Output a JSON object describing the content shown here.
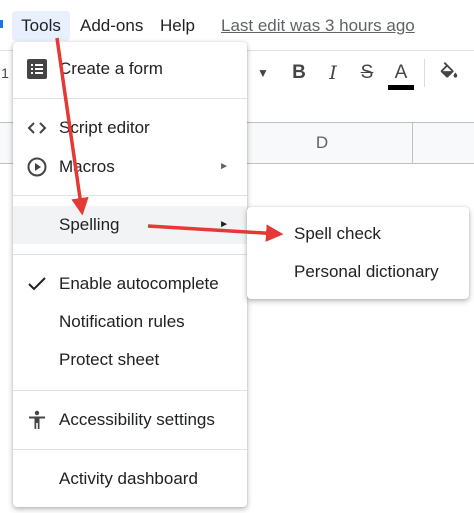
{
  "menubar": {
    "tools": "Tools",
    "addons": "Add-ons",
    "help": "Help",
    "last_edit": "Last edit was 3 hours ago"
  },
  "toolbar": {
    "font_size_fragment": "1",
    "bold": "B",
    "italic": "I",
    "strike": "S",
    "text_color": "A",
    "text_color_hex": "#000000"
  },
  "grid": {
    "column_d": "D"
  },
  "tools_menu": {
    "items": [
      {
        "label": "Create a form",
        "icon": "form-icon"
      },
      {
        "label": "Script editor",
        "icon": "code-icon"
      },
      {
        "label": "Macros",
        "icon": "play-circle-icon",
        "submenu": true
      },
      {
        "label": "Spelling",
        "icon": "",
        "submenu": true,
        "highlighted": true
      },
      {
        "label": "Enable autocomplete",
        "icon": "check-icon",
        "checked": true
      },
      {
        "label": "Notification rules",
        "icon": ""
      },
      {
        "label": "Protect sheet",
        "icon": ""
      },
      {
        "label": "Accessibility settings",
        "icon": "accessibility-icon"
      },
      {
        "label": "Activity dashboard",
        "icon": ""
      }
    ]
  },
  "spelling_submenu": {
    "items": [
      {
        "label": "Spell check"
      },
      {
        "label": "Personal dictionary"
      }
    ]
  },
  "annotation": {
    "arrow_color": "#e53935"
  }
}
